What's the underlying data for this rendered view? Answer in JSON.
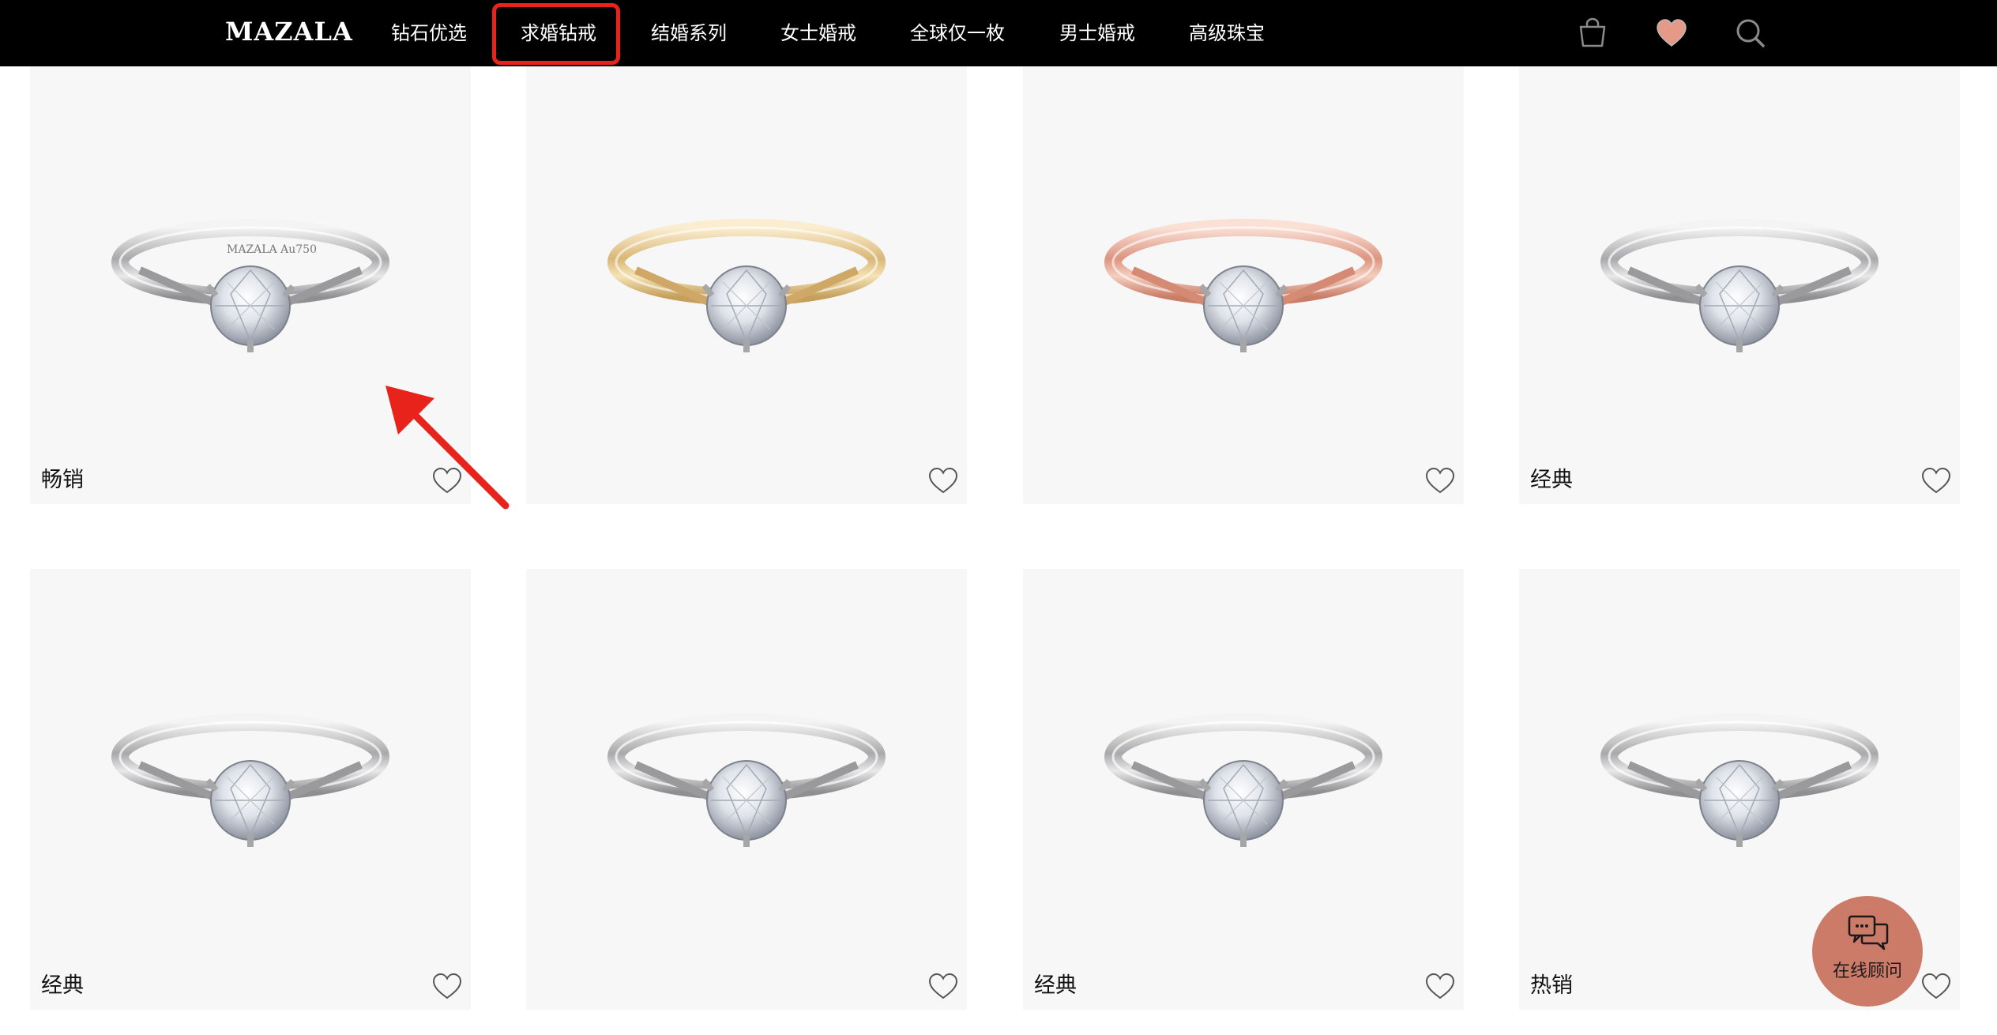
{
  "header": {
    "logo": "MAZALA",
    "nav": [
      {
        "label": "钻石优选"
      },
      {
        "label": "求婚钻戒"
      },
      {
        "label": "结婚系列"
      },
      {
        "label": "女士婚戒"
      },
      {
        "label": "全球仅一枚"
      },
      {
        "label": "男士婚戒"
      },
      {
        "label": "高级珠宝"
      }
    ],
    "active_nav": "求婚钻戒",
    "icons": [
      "bag-icon",
      "heart-icon",
      "search-icon"
    ],
    "heart_color": "#e59a87"
  },
  "products": [
    {
      "tag": "畅销",
      "metal": "white-gold",
      "engraving": "MAZALA  Au750"
    },
    {
      "tag": "",
      "metal": "yellow-gold",
      "engraving": ""
    },
    {
      "tag": "",
      "metal": "rose-gold",
      "engraving": ""
    },
    {
      "tag": "经典",
      "metal": "white-gold",
      "engraving": ""
    },
    {
      "tag": "经典",
      "metal": "white-gold",
      "engraving": ""
    },
    {
      "tag": "",
      "metal": "white-gold",
      "engraving": ""
    },
    {
      "tag": "经典",
      "metal": "white-gold",
      "engraving": ""
    },
    {
      "tag": "热销",
      "metal": "white-gold",
      "engraving": ""
    }
  ],
  "consult": {
    "label": "在线顾问",
    "color": "#cb7b68"
  },
  "annotation": {
    "highlight_color": "#e8231b"
  }
}
